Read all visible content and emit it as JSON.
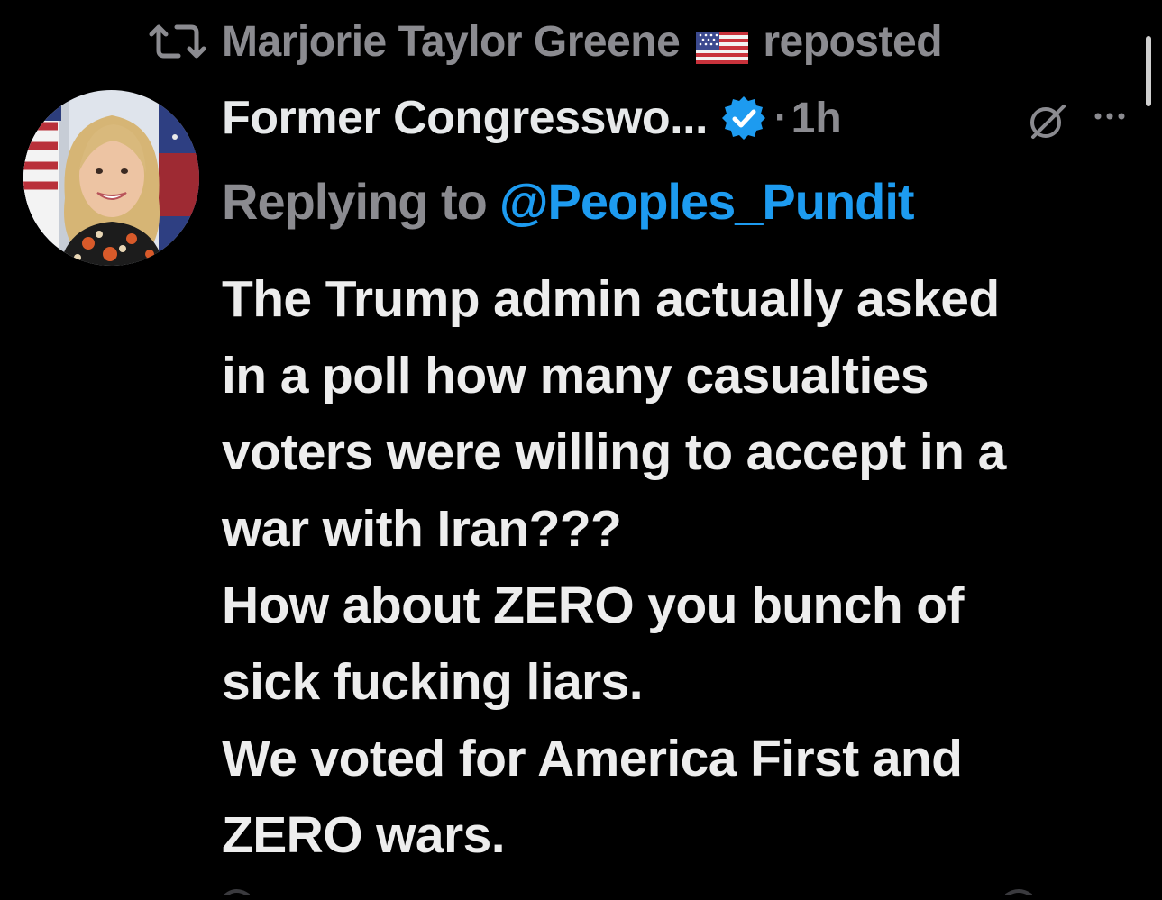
{
  "repost": {
    "icon": "repost-icon",
    "name": "Marjorie Taylor Greene",
    "flag": "🇺🇸",
    "label": "reposted"
  },
  "post": {
    "avatar": "avatar",
    "display_name": "Former Congresswo...",
    "verified": "verified-badge-icon",
    "separator": "·",
    "time": "1h",
    "grok_icon": "grok-icon",
    "more_icon": "more-icon",
    "reply_prefix": "Replying to",
    "reply_handle": "@Peoples_Pundit",
    "lines": [
      "The Trump admin actually asked",
      "in a poll how many casualties",
      "voters were willing to accept in a",
      "war with Iran???",
      "How about ZERO you bunch of",
      "sick fucking liars.",
      "We voted for America First and",
      "ZERO wars."
    ]
  },
  "colors": {
    "background": "#000000",
    "text": "#e7e9ea",
    "muted": "#8b8b90",
    "link": "#1d9bf0",
    "verified": "#1d9bf0"
  }
}
